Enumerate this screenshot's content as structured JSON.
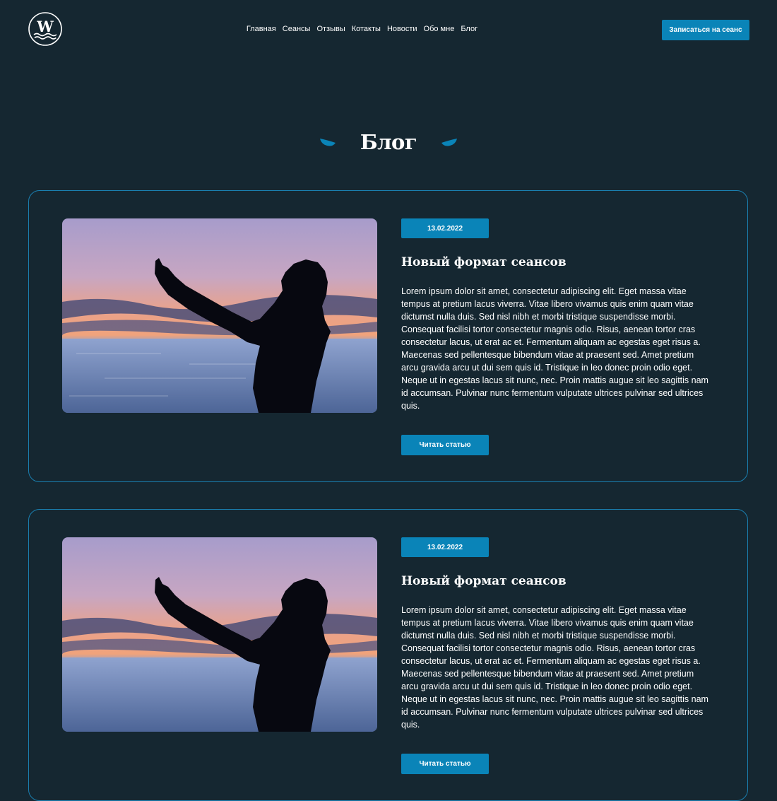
{
  "header": {
    "logo_letter": "W",
    "nav": [
      "Главная",
      "Сеансы",
      "Отзывы",
      "Котакты",
      "Новости",
      "Обо мне",
      "Блог"
    ],
    "cta_label": "Записаться на сеанс"
  },
  "page": {
    "title": "Блог"
  },
  "posts": [
    {
      "date": "13.02.2022",
      "title": "Новый формат сеансов",
      "text": "Lorem ipsum dolor sit amet, consectetur adipiscing elit. Eget massa vitae tempus at pretium lacus viverra. Vitae libero vivamus quis enim quam vitae dictumst nulla duis. Sed nisl nibh et morbi tristique suspendisse morbi. Consequat facilisi tortor consectetur magnis odio. Risus, aenean tortor cras consectetur lacus, ut erat ac et. Fermentum aliquam ac egestas eget risus a. Maecenas sed pellentesque bibendum vitae at praesent sed. Amet pretium arcu gravida arcu ut dui sem quis id. Tristique in leo donec proin odio eget. Neque ut in egestas lacus sit nunc, nec. Proin mattis augue sit leo sagittis nam id accumsan. Pulvinar nunc fermentum vulputate ultrices pulvinar sed ultrices quis.",
      "button": "Читать статью"
    },
    {
      "date": "13.02.2022",
      "title": "Новый формат сеансов",
      "text": "Lorem ipsum dolor sit amet, consectetur adipiscing elit. Eget massa vitae tempus at pretium lacus viverra. Vitae libero vivamus quis enim quam vitae dictumst nulla duis. Sed nisl nibh et morbi tristique suspendisse morbi. Consequat facilisi tortor consectetur magnis odio. Risus, aenean tortor cras consectetur lacus, ut erat ac et. Fermentum aliquam ac egestas eget risus a. Maecenas sed pellentesque bibendum vitae at praesent sed. Amet pretium arcu gravida arcu ut dui sem quis id. Tristique in leo donec proin odio eget. Neque ut in egestas lacus sit nunc, nec. Proin mattis augue sit leo sagittis nam id accumsan. Pulvinar nunc fermentum vulputate ultrices pulvinar sed ultrices quis.",
      "button": "Читать статью"
    }
  ],
  "colors": {
    "background": "#152731",
    "accent": "#0a84b8",
    "card_border": "#1a7fb0"
  },
  "icons": {
    "logo": "w-waves-logo-icon",
    "title_decor": "leaf-icon"
  }
}
